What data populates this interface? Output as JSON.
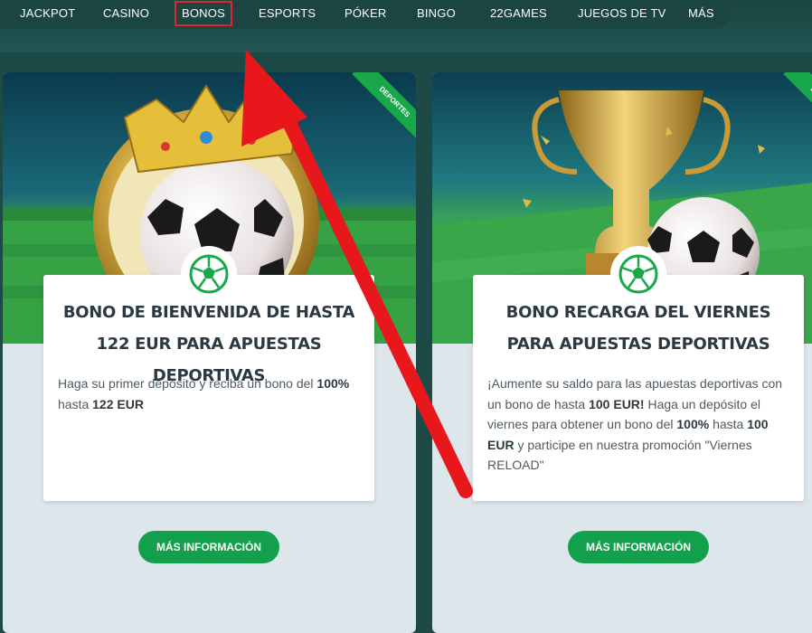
{
  "nav": {
    "items": [
      {
        "label": "JACKPOT"
      },
      {
        "label": "CASINO"
      },
      {
        "label": "BONOS"
      },
      {
        "label": "ESPORTS"
      },
      {
        "label": "PÓKER"
      },
      {
        "label": "BINGO"
      },
      {
        "label": "22GAMES"
      },
      {
        "label": "JUEGOS DE TV"
      },
      {
        "label": "MÁS"
      }
    ],
    "active": "BONOS"
  },
  "cards": [
    {
      "ribbon": "DEPORTES",
      "title": "BONO DE BIENVENIDA DE HASTA 122 EUR PARA APUESTAS DEPORTIVAS",
      "text": {
        "p1": "Haga su primer depósito y reciba un bono del ",
        "b1": "100%",
        "p2": " hasta ",
        "b2": "122 EUR"
      },
      "button": "MÁS INFORMACIÓN"
    },
    {
      "ribbon": "DEPORTES",
      "title": "BONO RECARGA DEL VIERNES PARA APUESTAS DEPORTIVAS",
      "text": {
        "p1": "¡Aumente su saldo para las apuestas deportivas con un bono de hasta ",
        "b1": "100 EUR!",
        "p2": " Haga un depósito el viernes para obtener un bono del ",
        "b2": "100%",
        "p3": " hasta ",
        "b3": "100 EUR",
        "p4": " y participe en nuestra promoción \"Viernes RELOAD\""
      },
      "button": "MÁS INFORMACIÓN"
    }
  ],
  "colors": {
    "accent_green": "#13a04c",
    "highlight_red": "#e0262a",
    "background": "#1d4a47"
  }
}
